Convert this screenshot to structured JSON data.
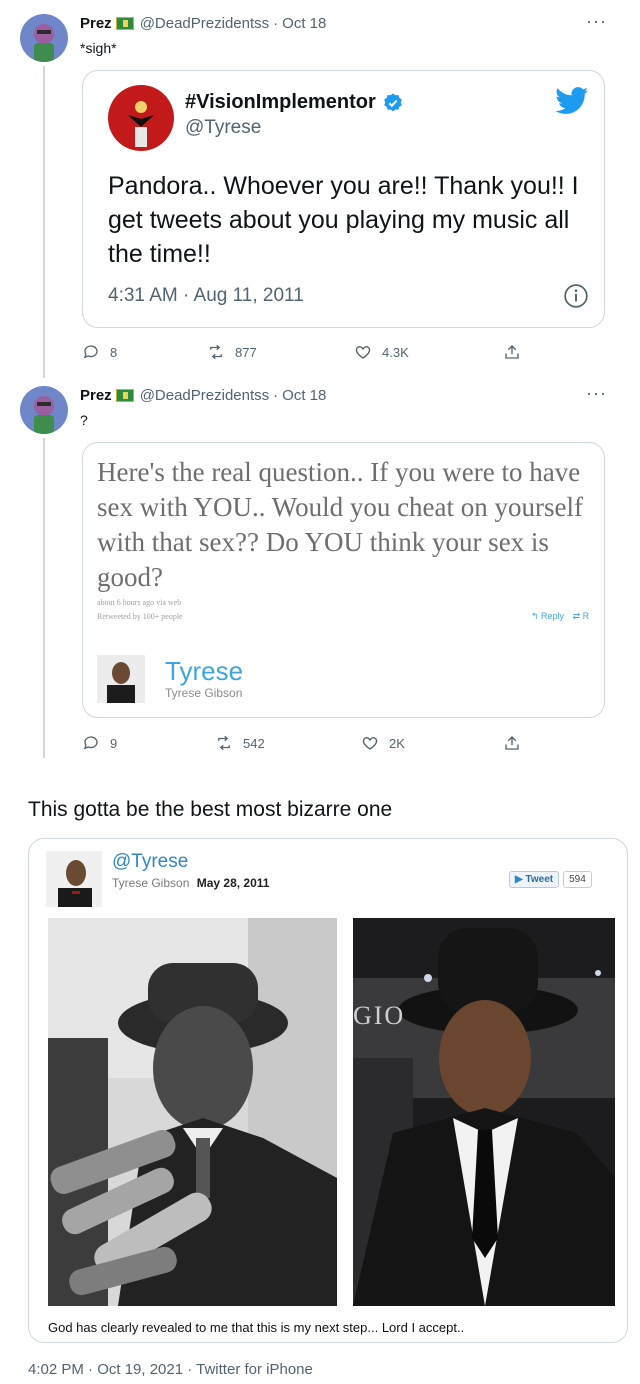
{
  "tweet1": {
    "display_name": "Prez",
    "handle": "@DeadPrezidentss",
    "date": "Oct 18",
    "text": "*sigh*",
    "more": "···",
    "quoted": {
      "display_name": "#VisionImplementor",
      "handle": "@Tyrese",
      "text": "Pandora.. Whoever you are!! Thank you!! I get tweets about you playing my music all the time!!",
      "timestamp": "4:31 AM · Aug 11, 2011",
      "info_icon": "info-icon",
      "twitter_icon": "twitter-bird-icon"
    },
    "stats": {
      "replies": "8",
      "retweets": "877",
      "likes": "4.3K"
    }
  },
  "tweet2": {
    "display_name": "Prez",
    "handle": "@DeadPrezidentss",
    "date": "Oct 18",
    "text": "?",
    "more": "···",
    "quoted": {
      "text": "Here's the real question.. If you were to have sex with YOU.. Would you cheat on yourself with that sex?? Do YOU think your sex is good?",
      "meta_line1": "about 6 hours ago via web",
      "meta_line2": "Retweeted by 100+ people",
      "reply_label": "Reply",
      "retweet_label": "R",
      "author_handle": "Tyrese",
      "author_name": "Tyrese Gibson"
    },
    "stats": {
      "replies": "9",
      "retweets": "542",
      "likes": "2K"
    }
  },
  "main": {
    "text": "This gotta be the best most bizarre one",
    "card": {
      "handle": "@Tyrese",
      "name": "Tyrese Gibson",
      "date": "May 28, 2011",
      "tweet_btn": "Tweet",
      "tweet_count": "594",
      "sign_text": "GIO",
      "caption": "God has clearly revealed to me that this is my next step... Lord I accept.."
    },
    "footer": "4:02 PM · Oct 19, 2021 · Twitter for iPhone"
  },
  "colors": {
    "accent": "#1d9bf0",
    "text": "#0f1419",
    "secondary": "#536471",
    "border": "#cfd9de"
  }
}
